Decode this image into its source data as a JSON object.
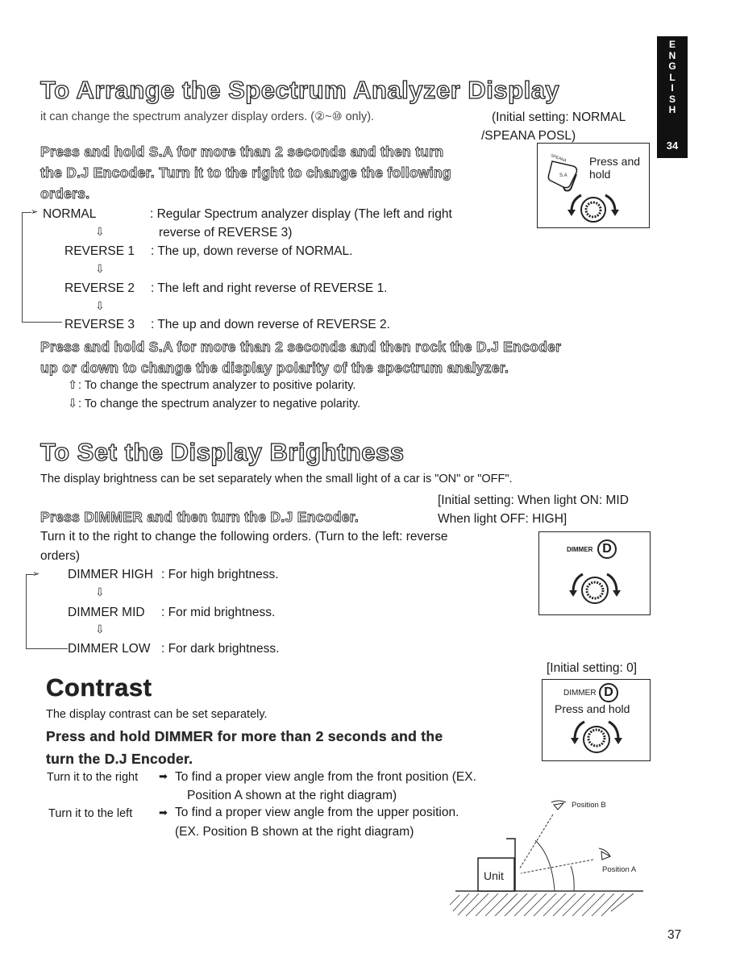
{
  "side_tab": {
    "letters": [
      "E",
      "N",
      "G",
      "L",
      "I",
      "S",
      "H"
    ],
    "section_number": "34"
  },
  "section1": {
    "title": "To Arrange the Spectrum Analyzer Display",
    "intro": "it can change the spectrum analyzer display orders. (②~⑩ only).",
    "initial_setting_line1": "(Initial setting: NORMAL",
    "initial_setting_line2": "/SPEANA POSL)",
    "instruction_lines": [
      "Press and hold S.A for more than 2 seconds and then turn",
      "the D.J Encoder. Turn it to the right to change the following",
      "orders."
    ],
    "figure": {
      "button_label": "SPEANA POSL",
      "button_face": "S.A",
      "caption_line1": "Press and",
      "caption_line2": "hold"
    },
    "orders": [
      {
        "name": "NORMAL",
        "desc": ": Regular Spectrum analyzer display (The left and right",
        "desc2": "reverse of REVERSE 3)"
      },
      {
        "name": "REVERSE 1",
        "desc": ": The up, down reverse of NORMAL."
      },
      {
        "name": "REVERSE 2",
        "desc": ": The left and right reverse of REVERSE 1."
      },
      {
        "name": "REVERSE 3",
        "desc": ": The up and down reverse of REVERSE 2."
      }
    ],
    "polarity_instruction_lines": [
      "Press and hold S.A for more than 2 seconds and then rock the D.J Encoder",
      "up or down to change the display polarity of the spectrum analyzer."
    ],
    "polarity": [
      {
        "icon": "⇧",
        "text": ": To change the spectrum analyzer to positive polarity."
      },
      {
        "icon": "⇩",
        "text": ": To change the spectrum analyzer to negative polarity."
      }
    ]
  },
  "section2": {
    "title": "To Set the Display Brightness",
    "intro": "The display brightness can be set separately when the small light of a car is \"ON\" or \"OFF\".",
    "initial_setting_line1": "[Initial setting: When light ON: MID",
    "initial_setting_line2": "When light OFF: HIGH]",
    "instruction": "Press DIMMER and then turn the D.J Encoder.",
    "turn_text_line1": "Turn it to the right to change the following orders. (Turn to the left: reverse",
    "turn_text_line2": "orders)",
    "figure": {
      "button_label": "DIMMER",
      "button_face": "D"
    },
    "orders": [
      {
        "name": "DIMMER HIGH",
        "desc": ": For high brightness."
      },
      {
        "name": "DIMMER MID",
        "desc": ": For mid brightness."
      },
      {
        "name": "DIMMER LOW",
        "desc": ": For dark brightness."
      }
    ]
  },
  "section3": {
    "title": "Contrast",
    "intro": "The display contrast can be set separately.",
    "initial_setting": "[Initial setting: 0]",
    "instruction_lines": [
      "Press and hold DIMMER for more than 2 seconds and the",
      "turn the D.J Encoder."
    ],
    "figure": {
      "button_label": "DIMMER",
      "button_face": "D",
      "caption": "Press and hold"
    },
    "rows": [
      {
        "label": "Turn it to the right",
        "arrow": "➡",
        "text": "To find a proper view angle from the front position (EX.",
        "text2": "Position A shown at the right diagram)"
      },
      {
        "label": "Turn it to the left",
        "arrow": "➡",
        "text": "To find a proper view angle from the upper position.",
        "text2": "(EX. Position B shown at the right diagram)"
      }
    ],
    "diagram": {
      "unit_label": "Unit",
      "position_a": "Position A",
      "position_b": "Position B"
    }
  },
  "page_number": "37"
}
